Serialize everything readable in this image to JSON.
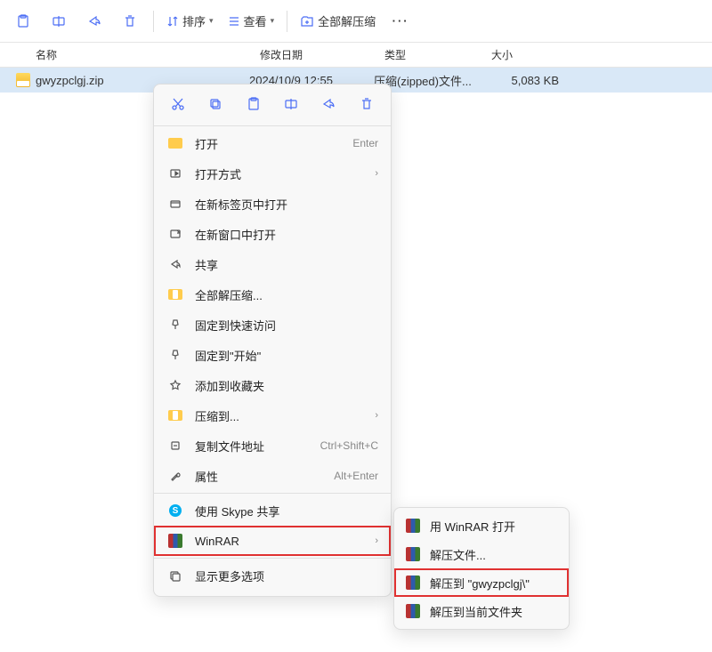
{
  "toolbar": {
    "sort_label": "排序",
    "view_label": "查看",
    "extract_all_label": "全部解压缩"
  },
  "headers": {
    "name": "名称",
    "date": "修改日期",
    "type": "类型",
    "size": "大小"
  },
  "files": [
    {
      "name": "gwyzpclgj.zip",
      "date": "2024/10/9 12:55",
      "type": "压缩(zipped)文件...",
      "size": "5,083 KB"
    }
  ],
  "context_menu": {
    "open": "打开",
    "open_shortcut": "Enter",
    "open_with": "打开方式",
    "open_new_tab": "在新标签页中打开",
    "open_new_window": "在新窗口中打开",
    "share": "共享",
    "extract_all": "全部解压缩...",
    "pin_quick": "固定到快速访问",
    "pin_start": "固定到\"开始\"",
    "add_fav": "添加到收藏夹",
    "compress": "压缩到...",
    "copy_path": "复制文件地址",
    "copy_path_shortcut": "Ctrl+Shift+C",
    "properties": "属性",
    "properties_shortcut": "Alt+Enter",
    "skype": "使用 Skype 共享",
    "winrar": "WinRAR",
    "more": "显示更多选项"
  },
  "submenu": {
    "open_winrar": "用 WinRAR 打开",
    "extract_files": "解压文件...",
    "extract_to_folder": "解压到 \"gwyzpclgj\\\"",
    "extract_here": "解压到当前文件夹"
  }
}
